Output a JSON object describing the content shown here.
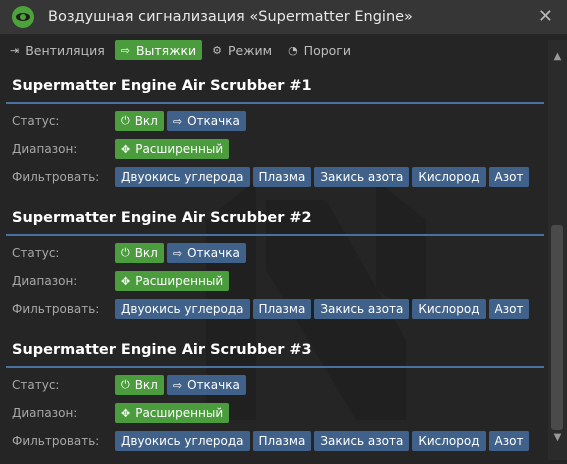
{
  "window": {
    "title": "Воздушная сигнализация «Supermatter Engine»"
  },
  "tabs": [
    {
      "label": "Вентиляция",
      "icon": "sign-out-icon"
    },
    {
      "label": "Вытяжки",
      "icon": "sign-in-icon",
      "active": true
    },
    {
      "label": "Режим",
      "icon": "cog-icon"
    },
    {
      "label": "Пороги",
      "icon": "gauge-icon"
    }
  ],
  "labels": {
    "status": "Статус:",
    "range": "Диапазон:",
    "filter": "Фильтровать:"
  },
  "scrubbers": [
    {
      "name": "Supermatter Engine Air Scrubber #1",
      "power": "Вкл",
      "mode": "Откачка",
      "range": "Расширенный",
      "filters": [
        "Двуокись углерода",
        "Плазма",
        "Закись азота",
        "Кислород",
        "Азот"
      ]
    },
    {
      "name": "Supermatter Engine Air Scrubber #2",
      "power": "Вкл",
      "mode": "Откачка",
      "range": "Расширенный",
      "filters": [
        "Двуокись углерода",
        "Плазма",
        "Закись азота",
        "Кислород",
        "Азот"
      ]
    },
    {
      "name": "Supermatter Engine Air Scrubber #3",
      "power": "Вкл",
      "mode": "Откачка",
      "range": "Расширенный",
      "filters": [
        "Двуокись углерода",
        "Плазма",
        "Закись азота",
        "Кислород",
        "Азот"
      ]
    }
  ],
  "scroll": {
    "thumb_start_fraction": 0.43,
    "thumb_length_fraction": 0.57
  },
  "colors": {
    "accent_green": "#4a9c3c",
    "filter_blue": "#40628a",
    "divider_blue": "#4972a1"
  }
}
